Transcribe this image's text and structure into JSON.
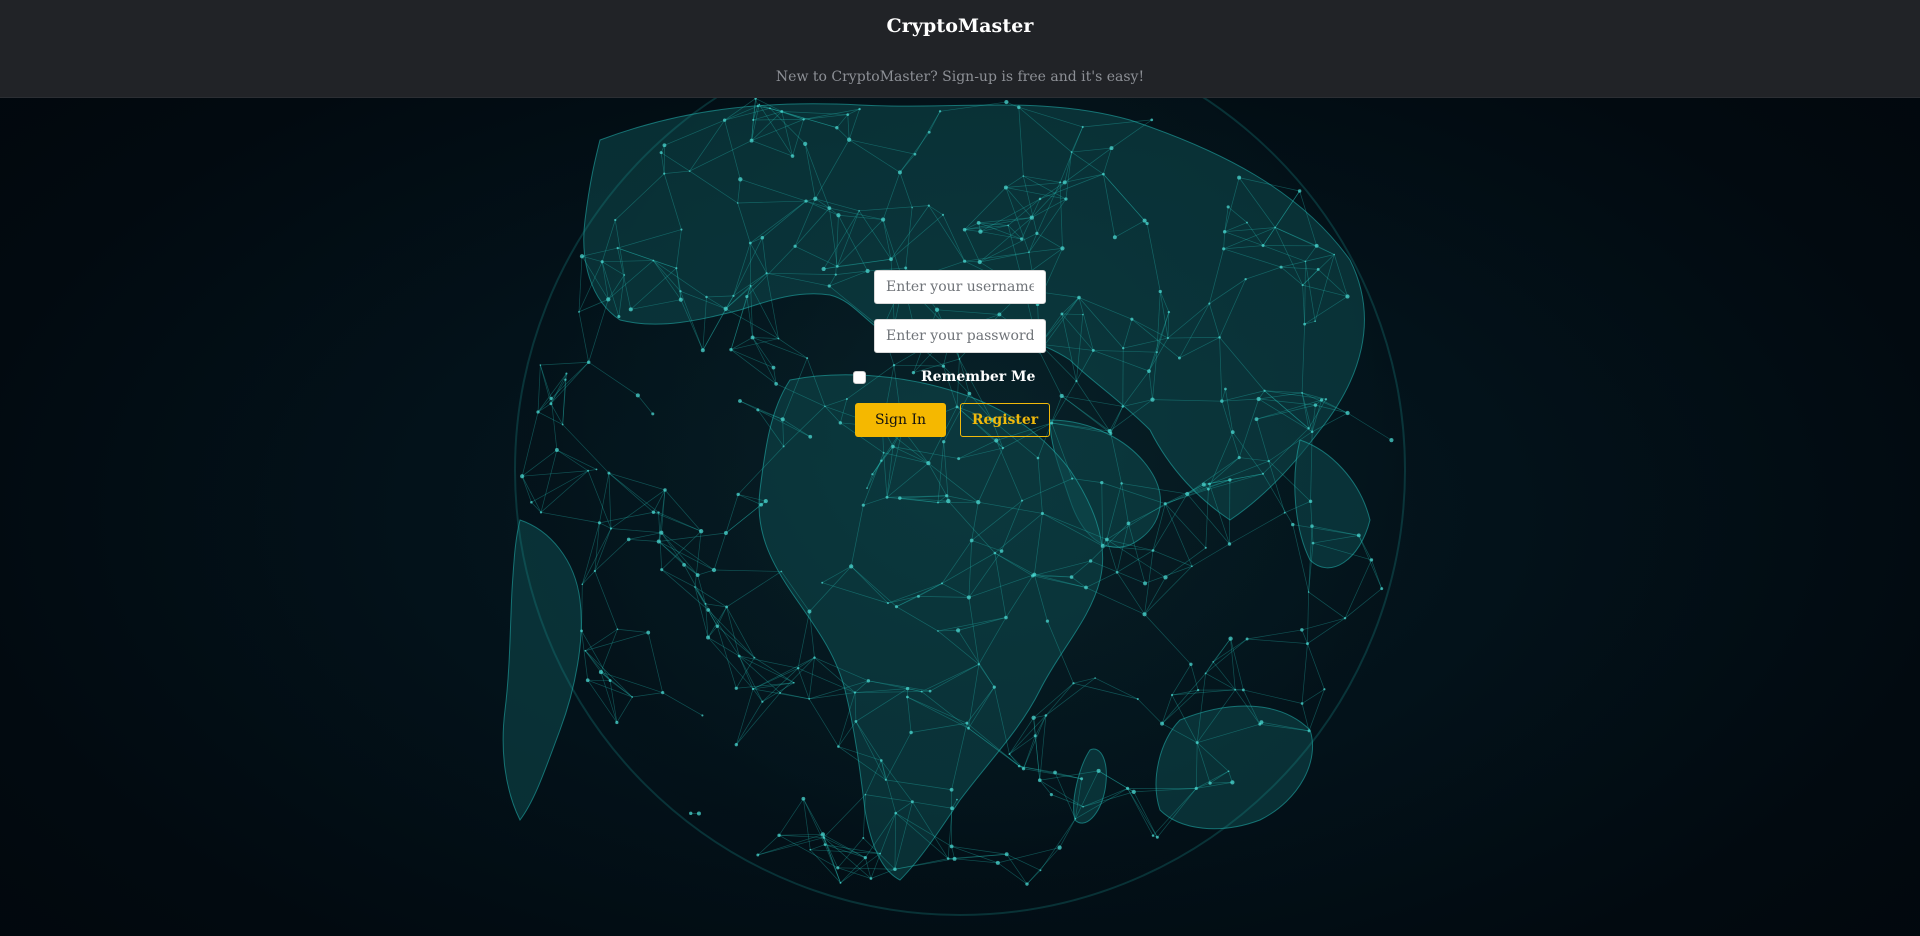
{
  "header": {
    "brand": "CryptoMaster",
    "signup_note": "New to CryptoMaster? Sign-up is free and it's easy!"
  },
  "login": {
    "username_placeholder": "Enter your username",
    "username_value": "",
    "password_placeholder": "Enter your password",
    "password_value": "",
    "remember_label": "Remember Me",
    "remember_checked": false,
    "signin_label": "Sign In",
    "register_label": "Register"
  },
  "colors": {
    "accent": "#f0b90b",
    "header_bg": "#212327",
    "globe": "#1fb5b0",
    "background": "#030d14"
  }
}
